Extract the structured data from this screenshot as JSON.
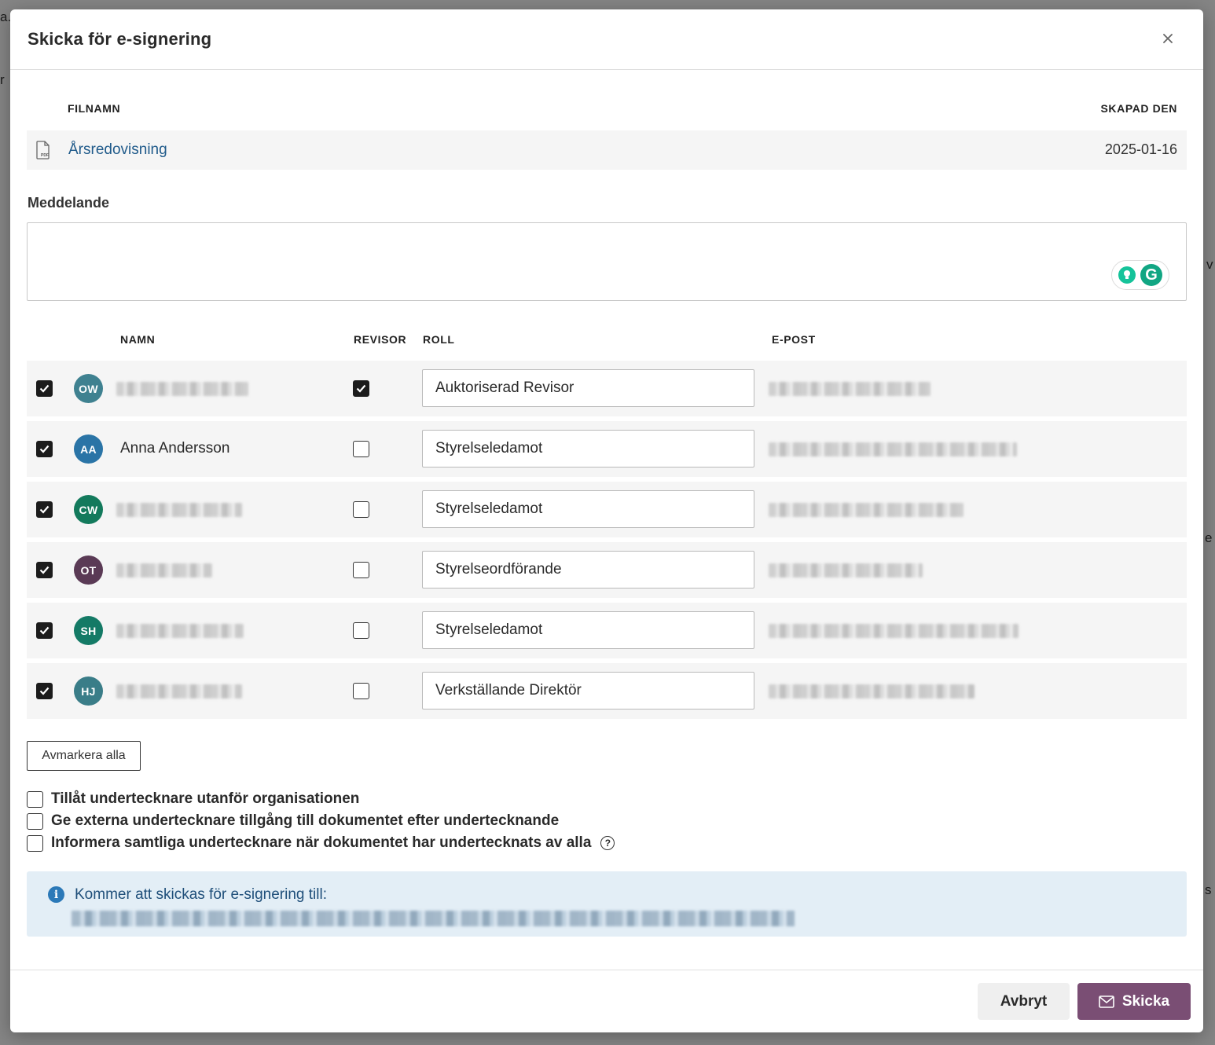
{
  "modal": {
    "title": "Skicka för e-signering",
    "close_glyph": "×"
  },
  "file_table": {
    "col_filename": "FILNAMN",
    "col_created": "SKAPAD DEN",
    "file": {
      "icon": "pdf-file-icon",
      "name": "Årsredovisning",
      "created": "2025-01-16"
    }
  },
  "message": {
    "label": "Meddelande",
    "value": "",
    "placeholder": ""
  },
  "signers_table": {
    "col_name": "NAMN",
    "col_auditor": "REVISOR",
    "col_role": "ROLL",
    "col_email": "E-POST",
    "rows": [
      {
        "initials": "OW",
        "avatar_color": "#3f8190",
        "name": "",
        "name_redacted": true,
        "selected": true,
        "auditor": true,
        "role": "Auktoriserad Revisor",
        "email_redacted": true
      },
      {
        "initials": "AA",
        "avatar_color": "#2a74a6",
        "name": "Anna Andersson",
        "name_redacted": false,
        "selected": true,
        "auditor": false,
        "role": "Styrelseledamot",
        "email_redacted": true
      },
      {
        "initials": "CW",
        "avatar_color": "#137a5c",
        "name": "",
        "name_redacted": true,
        "selected": true,
        "auditor": false,
        "role": "Styrelseledamot",
        "email_redacted": true
      },
      {
        "initials": "OT",
        "avatar_color": "#5a3a55",
        "name": "",
        "name_redacted": true,
        "selected": true,
        "auditor": false,
        "role": "Styrelseordförande",
        "email_redacted": true
      },
      {
        "initials": "SH",
        "avatar_color": "#147a66",
        "name": "",
        "name_redacted": true,
        "selected": true,
        "auditor": false,
        "role": "Styrelseledamot",
        "email_redacted": true
      },
      {
        "initials": "HJ",
        "avatar_color": "#3a7d88",
        "name": "",
        "name_redacted": true,
        "selected": true,
        "auditor": false,
        "role": "Verkställande Direktör",
        "email_redacted": true
      }
    ]
  },
  "deselect_all_label": "Avmarkera alla",
  "options": [
    {
      "label": "Tillåt undertecknare utanför organisationen",
      "checked": false,
      "help": false
    },
    {
      "label": "Ge externa undertecknare tillgång till dokumentet efter undertecknande",
      "checked": false,
      "help": false
    },
    {
      "label": "Informera samtliga undertecknare när dokumentet har undertecknats av alla",
      "checked": false,
      "help": true
    }
  ],
  "info": {
    "icon": "info-icon",
    "title": "Kommer att skickas för e-signering till:",
    "recipients_redacted": true
  },
  "footer": {
    "cancel_label": "Avbryt",
    "send_label": "Skicka",
    "send_icon": "envelope-icon",
    "send_color": "#7a4e74"
  }
}
